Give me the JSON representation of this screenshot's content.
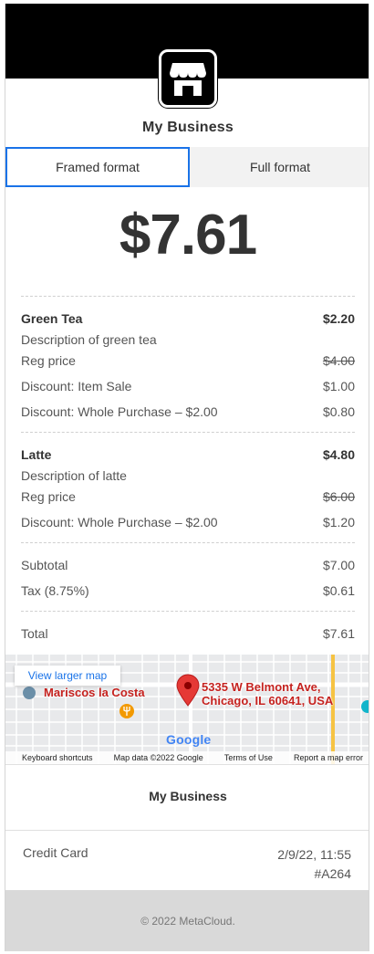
{
  "business": {
    "name": "My Business",
    "logo_icon": "storefront-icon"
  },
  "tabs": [
    {
      "label": "Framed format",
      "active": true
    },
    {
      "label": "Full format",
      "active": false
    }
  ],
  "amount": "$7.61",
  "items": [
    {
      "name": "Green Tea",
      "price": "$2.20",
      "description": "Description of green tea",
      "reg_price_label": "Reg price",
      "reg_price": "$4.00",
      "discounts": [
        {
          "label": "Discount: Item Sale",
          "value": "$1.00"
        },
        {
          "label": "Discount: Whole Purchase – $2.00",
          "value": "$0.80"
        }
      ]
    },
    {
      "name": "Latte",
      "price": "$4.80",
      "description": "Description of latte",
      "reg_price_label": "Reg price",
      "reg_price": "$6.00",
      "discounts": [
        {
          "label": "Discount: Whole Purchase – $2.00",
          "value": "$1.20"
        }
      ]
    }
  ],
  "totals": {
    "subtotal_label": "Subtotal",
    "subtotal": "$7.00",
    "tax_label": "Tax (8.75%)",
    "tax": "$0.61",
    "total_label": "Total",
    "total": "$7.61"
  },
  "map": {
    "view_larger": "View larger map",
    "place_label": "Mariscos la Costa",
    "address_line1": "5335 W Belmont Ave,",
    "address_line2": "Chicago, IL 60641, USA",
    "google": "Google",
    "footer": {
      "shortcuts": "Keyboard shortcuts",
      "map_data": "Map data ©2022 Google",
      "terms": "Terms of Use",
      "report": "Report a map error"
    }
  },
  "payment": {
    "method": "Credit Card",
    "datetime": "2/9/22, 11:55",
    "id": "#A264"
  },
  "copyright": "© 2022 MetaCloud.",
  "colors": {
    "accent": "#1a73e8",
    "text": "#333333",
    "muted": "#555555",
    "pin": "#e53935"
  }
}
